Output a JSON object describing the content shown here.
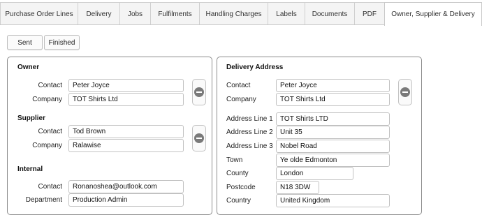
{
  "tabs": [
    {
      "label": "Purchase Order Lines"
    },
    {
      "label": "Delivery"
    },
    {
      "label": "Jobs"
    },
    {
      "label": "Fulfilments"
    },
    {
      "label": "Handling Charges"
    },
    {
      "label": "Labels"
    },
    {
      "label": "Documents"
    },
    {
      "label": "PDF"
    },
    {
      "label": "Owner, Supplier & Delivery",
      "active": true
    }
  ],
  "actions": {
    "sent_label": "Sent",
    "finished_label": "Finished"
  },
  "owner": {
    "heading": "Owner",
    "contact_label": "Contact",
    "contact_value": "Peter Joyce",
    "company_label": "Company",
    "company_value": "TOT Shirts Ltd"
  },
  "supplier": {
    "heading": "Supplier",
    "contact_label": "Contact",
    "contact_value": "Tod Brown",
    "company_label": "Company",
    "company_value": "Ralawise"
  },
  "internal": {
    "heading": "Internal",
    "contact_label": "Contact",
    "contact_value": "Ronanoshea@outlook.com",
    "department_label": "Department",
    "department_value": "Production Admin"
  },
  "delivery": {
    "heading": "Delivery Address",
    "contact_label": "Contact",
    "contact_value": "Peter Joyce",
    "company_label": "Company",
    "company_value": "TOT Shirts Ltd",
    "address1_label": "Address Line 1",
    "address1_value": "TOT Shirts LTD",
    "address2_label": "Address Line 2",
    "address2_value": "Unit 35",
    "address3_label": "Address Line 3",
    "address3_value": "Nobel Road",
    "town_label": "Town",
    "town_value": "Ye olde Edmonton",
    "county_label": "County",
    "county_value": "London",
    "postcode_label": "Postcode",
    "postcode_value": "N18 3DW",
    "country_label": "Country",
    "country_value": "United Kingdom"
  }
}
